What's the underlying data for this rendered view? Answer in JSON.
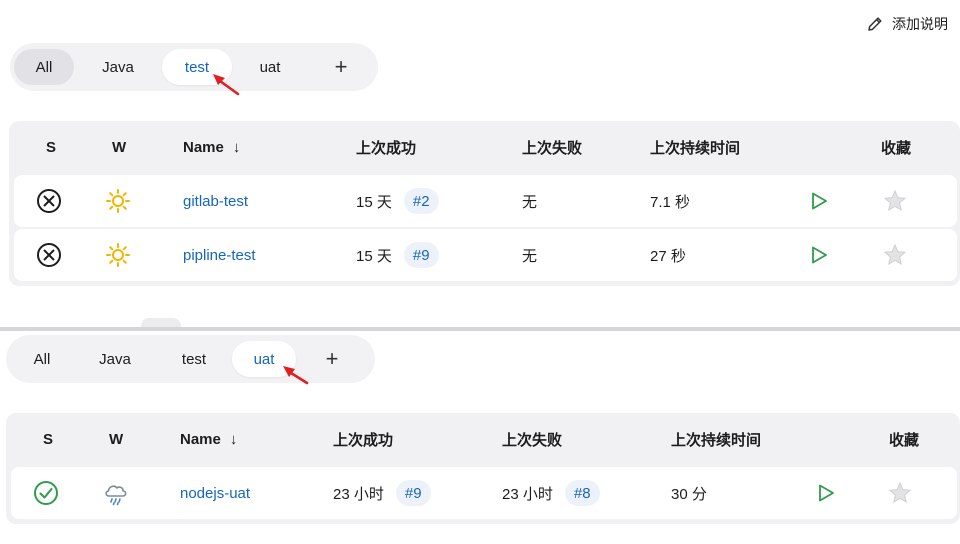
{
  "top": {
    "add_description": "添加说明",
    "tabs": [
      "All",
      "Java",
      "test",
      "uat"
    ],
    "table": {
      "headers": {
        "s": "S",
        "w": "W",
        "name": "Name",
        "sort_arrow": "↓",
        "last_success": "上次成功",
        "last_failure": "上次失败",
        "last_duration": "上次持续时间",
        "favorite": "收藏"
      },
      "rows": [
        {
          "status": "failed-icon",
          "weather": "sun-icon",
          "name": "gitlab-test",
          "success_time": "15 天",
          "success_build": "#2",
          "failure_time": "无",
          "failure_build": "",
          "duration": "7.1 秒"
        },
        {
          "status": "failed-icon",
          "weather": "sun-icon",
          "name": "pipline-test",
          "success_time": "15 天",
          "success_build": "#9",
          "failure_time": "无",
          "failure_build": "",
          "duration": "27 秒"
        }
      ]
    }
  },
  "bottom": {
    "tabs": [
      "All",
      "Java",
      "test",
      "uat"
    ],
    "table": {
      "headers": {
        "s": "S",
        "w": "W",
        "name": "Name",
        "sort_arrow": "↓",
        "last_success": "上次成功",
        "last_failure": "上次失败",
        "last_duration": "上次持续时间",
        "favorite": "收藏"
      },
      "rows": [
        {
          "status": "success-icon",
          "weather": "rain-cloud-icon",
          "name": "nodejs-uat",
          "success_time": "23 小时",
          "success_build": "#9",
          "failure_time": "23 小时",
          "failure_build": "#8",
          "duration": "30 分"
        }
      ]
    }
  },
  "colors": {
    "link": "#1565c0",
    "play": "#2e9d4a",
    "success": "#2e9d4a",
    "sun": "#f5b400",
    "arrow": "#e02020"
  }
}
